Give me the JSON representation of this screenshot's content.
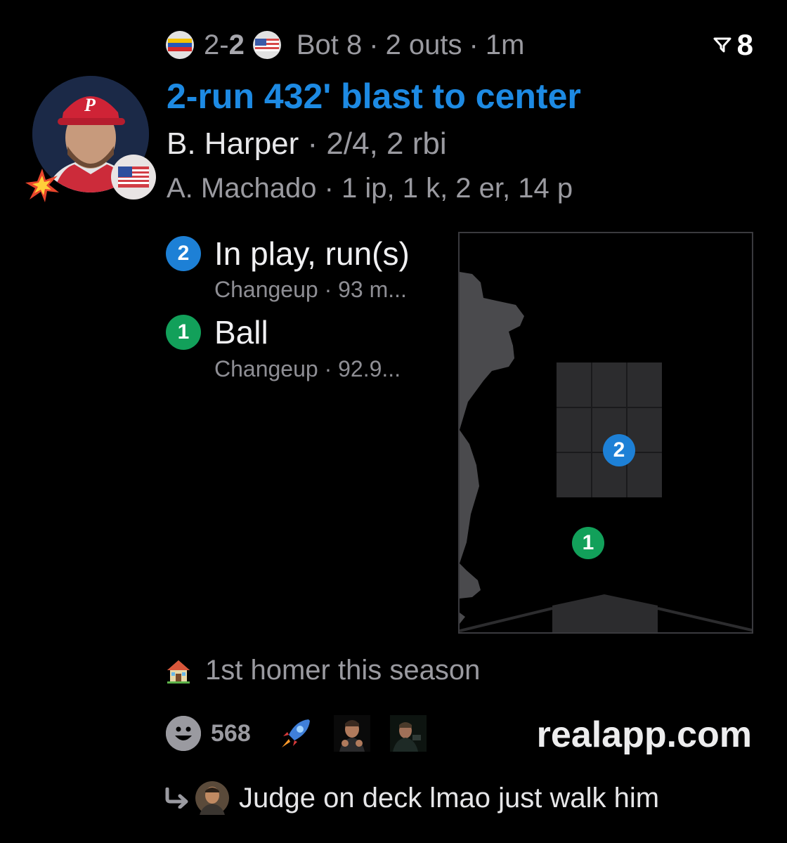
{
  "header": {
    "away_flag": "venezuela-flag",
    "away_score": "2",
    "separator": "-",
    "home_score": "2",
    "home_flag": "usa-flag",
    "inning": "Bot 8",
    "outs": "2 outs",
    "time_ago": "1m",
    "dot": "·",
    "filter_count": "8"
  },
  "play": {
    "headline": "2-run 432' blast to center",
    "batter_name": "B. Harper",
    "batter_stats": "· 2/4, 2 rbi",
    "pitcher_line": "A. Machado · 1 ip, 1 k, 2 er, 14 p"
  },
  "pitches": [
    {
      "num": "2",
      "result": "In play, run(s)",
      "detail": "Changeup ·  93 m...",
      "color": "#1d80d6"
    },
    {
      "num": "1",
      "result": "Ball",
      "detail": "Changeup ·  92.9...",
      "color": "#12a05a"
    }
  ],
  "zone_markers": [
    {
      "num": "2",
      "color": "#1d80d6"
    },
    {
      "num": "1",
      "color": "#12a05a"
    }
  ],
  "note": {
    "icon": "house-icon",
    "text": "1st homer this season"
  },
  "footer": {
    "reaction_count": "568",
    "brand": "realapp.com"
  },
  "reply": {
    "text": "Judge on deck lmao just walk him"
  }
}
